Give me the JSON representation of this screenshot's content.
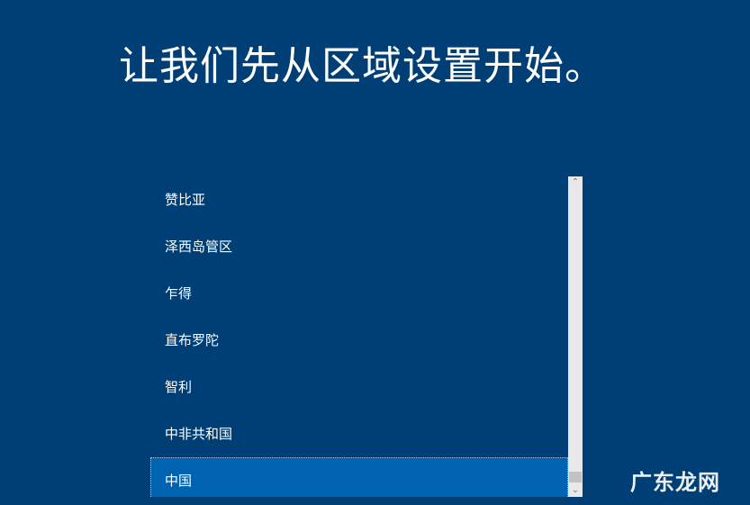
{
  "page": {
    "title": "让我们先从区域设置开始。"
  },
  "region_list": {
    "items": [
      {
        "label": "赞比亚"
      },
      {
        "label": "泽西岛管区"
      },
      {
        "label": "乍得"
      },
      {
        "label": "直布罗陀"
      },
      {
        "label": "智利"
      },
      {
        "label": "中非共和国"
      },
      {
        "label": "中国"
      }
    ],
    "selected_label": "中国"
  },
  "scrollbar": {
    "up_icon": "chevron-up-icon",
    "down_icon": "chevron-down-icon"
  },
  "watermark": {
    "text": "广东龙网"
  },
  "colors": {
    "background": "#003f75",
    "selected_item": "#0063b1",
    "scrollbar_track": "#e8e8e8",
    "scrollbar_thumb": "#c2c2c2"
  }
}
